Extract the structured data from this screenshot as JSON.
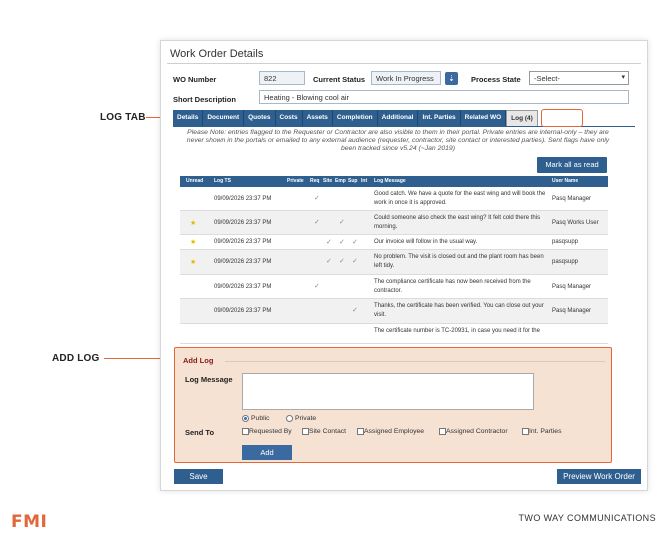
{
  "callouts": {
    "log_tab": "LOG TAB",
    "add_log": "ADD LOG"
  },
  "window": {
    "title": "Work Order Details"
  },
  "form": {
    "wo_number_label": "WO Number",
    "wo_number_value": "822",
    "status_label": "Current Status",
    "status_value": "Work In Progress",
    "process_label": "Process State",
    "process_value": "-Select-",
    "short_desc_label": "Short Description",
    "short_desc_value": "Heating - Blowing cool air"
  },
  "tabs": [
    {
      "label": "Details"
    },
    {
      "label": "Document"
    },
    {
      "label": "Quotes"
    },
    {
      "label": "Costs"
    },
    {
      "label": "Assets"
    },
    {
      "label": "Completion"
    },
    {
      "label": "Additional"
    },
    {
      "label": "Int. Parties"
    },
    {
      "label": "Related WO"
    },
    {
      "label": "Log (4)"
    }
  ],
  "note": "Please Note: entries flagged to the Requester or Contractor are also visible to them in their portal. Private entries are internal-only – they are never shown in the portals or emailed to any external audience (requester, contractor, site contact or interested parties). Sent flags have only been tracked since v5.24 (~Jan 2019)",
  "mark_all_label": "Mark all as read",
  "table": {
    "headers": {
      "unread": "Unread",
      "log_ts": "Log TS",
      "private": "Private",
      "req": "Req",
      "site": "Site",
      "emp": "Emp",
      "sup": "Sup",
      "int": "Int",
      "message": "Log Message",
      "user": "User Name"
    },
    "rows": [
      {
        "ts": "09/09/2026 23:37 PM",
        "msg": "Good catch. We have a quote for the east wing and will book the work in once it is approved.",
        "user": "Pasq Manager"
      },
      {
        "ts": "09/09/2026 23:37 PM",
        "msg": "Could someone also check the east wing? It felt cold there this morning.",
        "user": "Pasq Works User"
      },
      {
        "ts": "09/09/2026 23:37 PM",
        "msg": "Our invoice will follow in the usual way.",
        "user": "pasqsupp"
      },
      {
        "ts": "09/09/2026 23:37 PM",
        "msg": "No problem. The visit is closed out and the plant room has been left tidy.",
        "user": "pasqsupp"
      },
      {
        "ts": "09/09/2026 23:37 PM",
        "msg": "The compliance certificate has now been received from the contractor.",
        "user": "Pasq Manager"
      },
      {
        "ts": "09/09/2026 23:37 PM",
        "msg": "Thanks, the certificate has been verified. You can close out your visit.",
        "user": "Pasq Manager"
      },
      {
        "ts": "",
        "msg": "The certificate number is TC-20931, in case you need it for the",
        "user": ""
      }
    ]
  },
  "addlog": {
    "title": "Add Log",
    "message_label": "Log Message",
    "public_label": "Public",
    "private_label": "Private",
    "send_to_label": "Send To",
    "recipients": [
      "Requested By",
      "Site Contact",
      "Assigned Employee",
      "Assigned Contractor",
      "Int. Parties"
    ],
    "add_label": "Add"
  },
  "footer": {
    "save_label": "Save",
    "preview_label": "Preview Work Order"
  },
  "brand": {
    "logo": "FMI",
    "tagline": "TWO WAY COMMUNICATIONS"
  },
  "colors": {
    "accent": "#e0683a",
    "primary": "#2f5f8f",
    "panel": "#f5e2d3"
  }
}
